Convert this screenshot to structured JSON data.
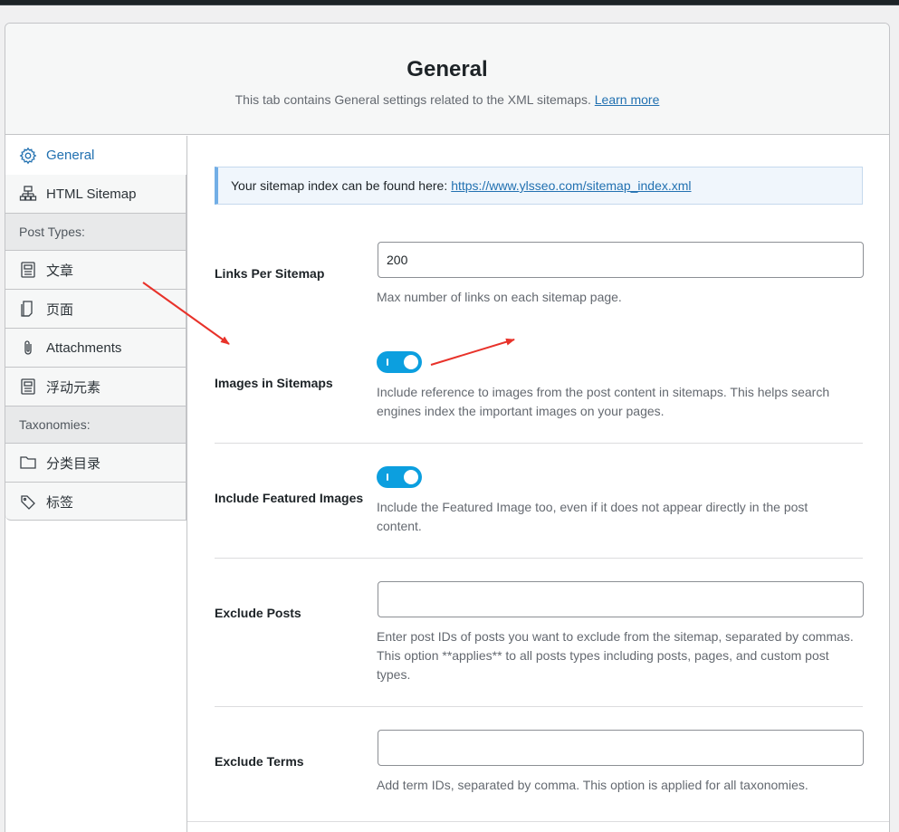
{
  "header": {
    "title": "General",
    "description": "This tab contains General settings related to the XML sitemaps.",
    "learn_more": "Learn more"
  },
  "sidebar": {
    "items_top": [
      {
        "label": "General",
        "icon": "gear-icon"
      },
      {
        "label": "HTML Sitemap",
        "icon": "sitemap-icon"
      }
    ],
    "post_types_heading": "Post Types:",
    "post_types": [
      {
        "label": "文章",
        "icon": "post-icon"
      },
      {
        "label": "页面",
        "icon": "page-icon"
      },
      {
        "label": "Attachments",
        "icon": "paperclip-icon"
      },
      {
        "label": "浮动元素",
        "icon": "post-icon"
      }
    ],
    "taxonomies_heading": "Taxonomies:",
    "taxonomies": [
      {
        "label": "分类目录",
        "icon": "folder-icon"
      },
      {
        "label": "标签",
        "icon": "tag-icon"
      }
    ]
  },
  "notice": {
    "text": "Your sitemap index can be found here:",
    "link": "https://www.ylsseo.com/sitemap_index.xml"
  },
  "settings": {
    "links_per_sitemap": {
      "label": "Links Per Sitemap",
      "value": "200",
      "description": "Max number of links on each sitemap page."
    },
    "images_in_sitemaps": {
      "label": "Images in Sitemaps",
      "enabled": true,
      "description_line1": "Include reference to images from the post content in sitemaps. This helps search",
      "description_line2": "engines index the important images on your pages."
    },
    "include_featured_images": {
      "label": "Include Featured Images",
      "enabled": true,
      "description_line1": "Include the Featured Image too, even if it does not appear directly in the post",
      "description_line2": "content."
    },
    "exclude_posts": {
      "label": "Exclude Posts",
      "value": "",
      "description_line1": "Enter post IDs of posts you want to exclude from the sitemap, separated by commas.",
      "description_line2": "This option **applies** to all posts types including posts, pages, and custom post",
      "description_line3": "types."
    },
    "exclude_terms": {
      "label": "Exclude Terms",
      "value": "",
      "description": "Add term IDs, separated by comma. This option is applied for all taxonomies."
    }
  },
  "colors": {
    "accent": "#2271b1",
    "toggle_on": "#0c9fdf",
    "annotation_arrow": "#e8322a"
  }
}
